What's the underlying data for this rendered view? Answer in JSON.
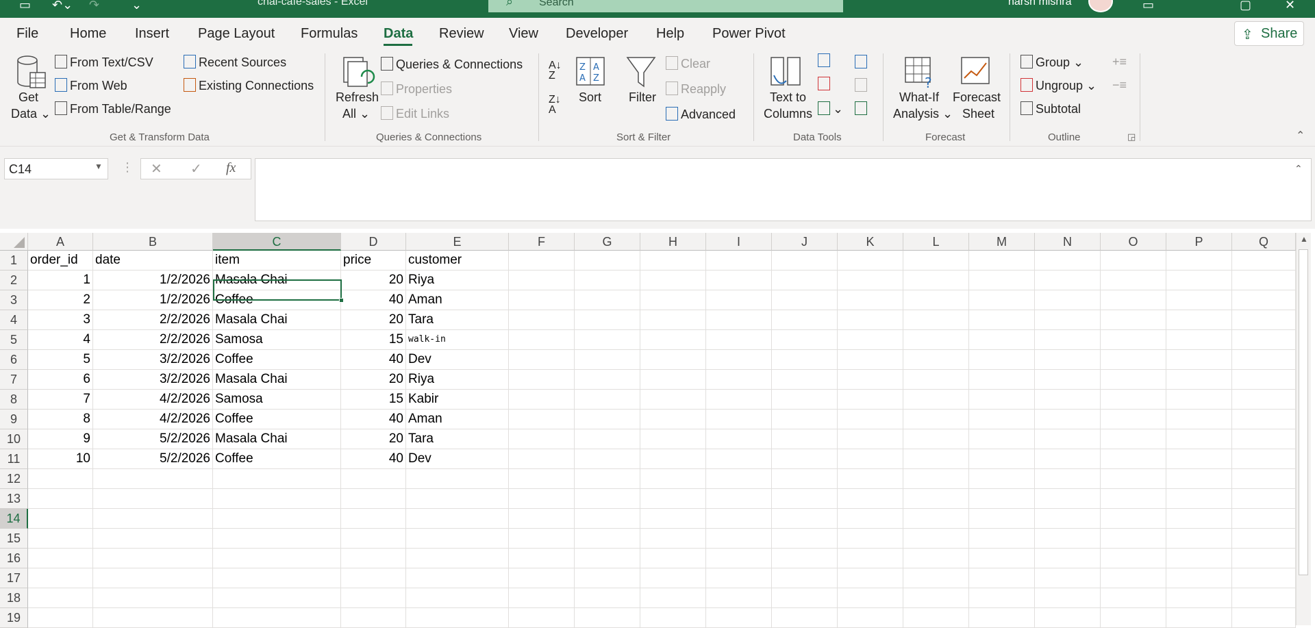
{
  "titlebar": {
    "doc_title": "chai-cafe-sales - Excel",
    "search_placeholder": "Search",
    "user_name": "harsh mishra"
  },
  "tabs": [
    "File",
    "Home",
    "Insert",
    "Page Layout",
    "Formulas",
    "Data",
    "Review",
    "View",
    "Developer",
    "Help",
    "Power Pivot"
  ],
  "active_tab": "Data",
  "share_label": "Share",
  "ribbon": {
    "get_transform": {
      "get_data": [
        "Get",
        "Data ⌄"
      ],
      "from_text_csv": "From Text/CSV",
      "from_web": "From Web",
      "from_table_range": "From Table/Range",
      "recent_sources": "Recent Sources",
      "existing_connections": "Existing Connections",
      "label": "Get & Transform Data"
    },
    "queries": {
      "refresh_all": [
        "Refresh",
        "All ⌄"
      ],
      "queries_connections": "Queries & Connections",
      "properties": "Properties",
      "edit_links": "Edit Links",
      "label": "Queries & Connections"
    },
    "sort_filter": {
      "sort": "Sort",
      "filter": "Filter",
      "clear": "Clear",
      "reapply": "Reapply",
      "advanced": "Advanced",
      "label": "Sort & Filter"
    },
    "data_tools": {
      "text_to_columns": [
        "Text to",
        "Columns"
      ],
      "label": "Data Tools"
    },
    "forecast": {
      "what_if": [
        "What-If",
        "Analysis ⌄"
      ],
      "forecast_sheet": [
        "Forecast",
        "Sheet"
      ],
      "label": "Forecast"
    },
    "outline": {
      "group": "Group",
      "ungroup": "Ungroup",
      "subtotal": "Subtotal",
      "label": "Outline"
    }
  },
  "formula_bar": {
    "name_box": "C14",
    "formula": ""
  },
  "columns": [
    "A",
    "B",
    "C",
    "D",
    "E",
    "F",
    "G",
    "H",
    "I",
    "J",
    "K",
    "L",
    "M",
    "N",
    "O",
    "P",
    "Q"
  ],
  "selected_column": "C",
  "selected_row": 14,
  "rows": [
    "1",
    "2",
    "3",
    "4",
    "5",
    "6",
    "7",
    "8",
    "9",
    "10",
    "11",
    "12",
    "13",
    "14",
    "15",
    "16",
    "17",
    "18",
    "19"
  ],
  "sheet": {
    "header": [
      "order_id",
      "date",
      "item",
      "price",
      "customer"
    ],
    "data": [
      [
        "1",
        "1/2/2026",
        "Masala Chai",
        "20",
        "Riya"
      ],
      [
        "2",
        "1/2/2026",
        "Coffee",
        "40",
        "Aman"
      ],
      [
        "3",
        "2/2/2026",
        "Masala Chai",
        "20",
        "Tara"
      ],
      [
        "4",
        "2/2/2026",
        "Samosa",
        "15",
        "walk-in"
      ],
      [
        "5",
        "3/2/2026",
        "Coffee",
        "40",
        "Dev"
      ],
      [
        "6",
        "3/2/2026",
        "Masala Chai",
        "20",
        "Riya"
      ],
      [
        "7",
        "4/2/2026",
        "Samosa",
        "15",
        "Kabir"
      ],
      [
        "8",
        "4/2/2026",
        "Coffee",
        "40",
        "Aman"
      ],
      [
        "9",
        "5/2/2026",
        "Masala Chai",
        "20",
        "Tara"
      ],
      [
        "10",
        "5/2/2026",
        "Coffee",
        "40",
        "Dev"
      ]
    ]
  }
}
